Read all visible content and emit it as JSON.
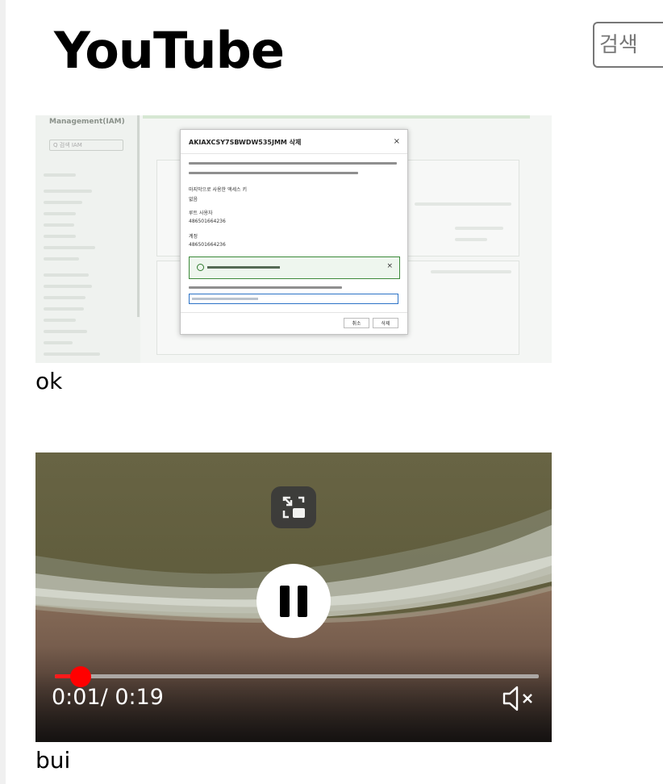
{
  "header": {
    "logo_text": "YouTube",
    "search_placeholder": "검색"
  },
  "videos": [
    {
      "caption": "ok",
      "thumbnail": {
        "sidebar_title": "Management(IAM)",
        "sidebar_search": "Q 검색 IAM",
        "dialog_title": "AKIAXCSY7SBWDW535JMM 삭제",
        "dialog_close": "×",
        "field_label_1": "마지막으로 사용한 액세스 키",
        "field_value_1": "없음",
        "field_label_2": "루트 사용자",
        "field_value_2": "486501664236",
        "field_label_3": "계정",
        "field_value_3": "486501664236",
        "alert_close": "×",
        "cancel_label": "취소",
        "delete_label": "삭제"
      }
    },
    {
      "caption": "bui",
      "player": {
        "state": "playing",
        "current_time": "0:01",
        "duration": "0:19",
        "progress": 0.0526,
        "muted": true,
        "progress_color": "#ff0000",
        "pip_icon": "picture-in-picture-exit-icon",
        "play_icon": "pause-icon",
        "volume_icon": "volume-muted-icon"
      }
    }
  ]
}
